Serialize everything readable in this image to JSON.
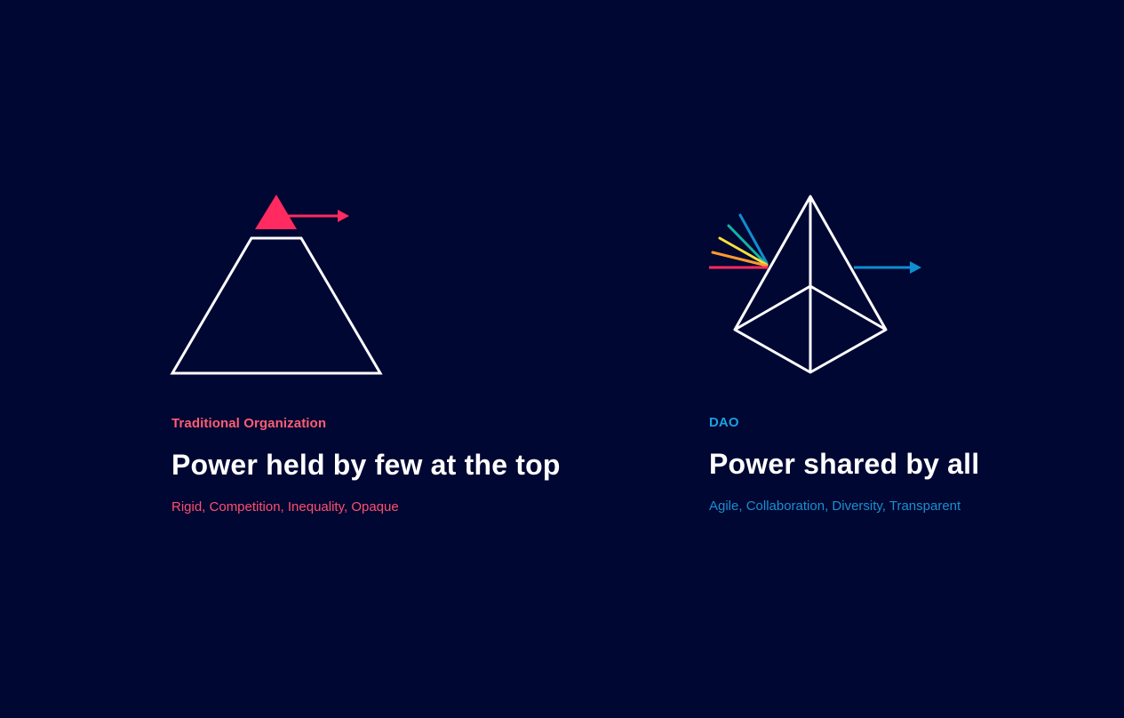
{
  "panels": [
    {
      "id": "traditional",
      "icon": "pyramid-with-peak-arrow-icon",
      "accent_color": "#ff2a5f",
      "label": "Traditional Organization",
      "headline": "Power held by few at the top",
      "traits": "Rigid, Competition, Inequality, Opaque"
    },
    {
      "id": "dao",
      "icon": "prism-spectrum-icon",
      "accent_color": "#0e8fd0",
      "label": "DAO",
      "headline": "Power shared by all",
      "traits": "Agile, Collaboration, Diversity, Transparent"
    }
  ],
  "colors": {
    "background": "#000733",
    "headline": "#ffffff",
    "spectrum": [
      "#0e8fd0",
      "#13b3a4",
      "#f5e13a",
      "#ff9a2e",
      "#ff2a5f"
    ]
  }
}
